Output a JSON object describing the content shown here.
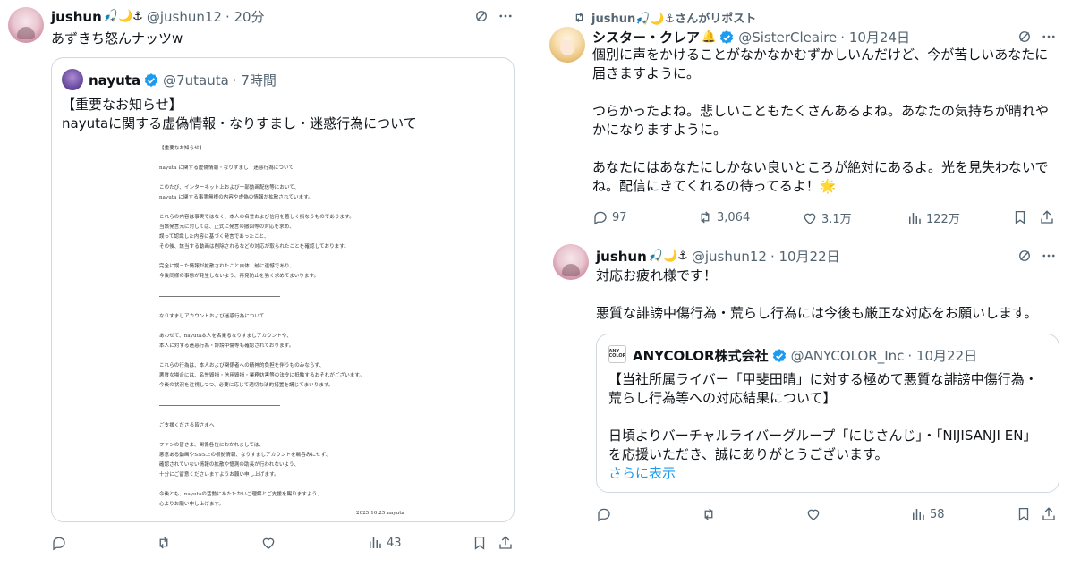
{
  "left_post": {
    "author_name": "jushun",
    "author_emoji": "🎣🌙⚓",
    "handle": "@jushun12",
    "time": "· 20分",
    "text": "あずきち怒んナッツw",
    "quote": {
      "author_name": "nayuta",
      "handle": "@7utauta",
      "time": "· 7時間",
      "text_line1": "【重要なお知らせ】",
      "text_line2": "nayutaに関する虚偽情報・なりすまし・迷惑行為について",
      "document": {
        "title": "【重要なお知らせ】",
        "subject": "nayuta に関する虚偽情報・なりすまし・迷惑行為について",
        "lines": [
          "このたび、インターネット上および一部動画配信等において、",
          "nayuta に関する事実無根の内容や虚偽の情報が拡散されています。",
          "これらの内容は事実ではなく、本人の名誉および信用を著しく損なうものであります。",
          "当該発言元に対しては、正式に発言の撤回等の対応を求め、",
          "誤って認識した内容に基づく発言であったこと、",
          "その後、該当する動画は削除されるなどの対応が取られたことを確認しております。",
          "完全に誤った情報が拡散されたこと自体、誠に遺憾であり、",
          "今後同様の事態が発生しないよう、再発防止を強く求めてまいります。",
          "なりすましアカウントおよび迷惑行為について",
          "あわせて、nayuta本人を名乗るなりすましアカウントや、",
          "本人に対する迷惑行為・誹謗中傷等も確認されております。",
          "これらの行為は、本人および関係者への精神的負担を伴うものみならず、",
          "悪質な場合には、名誉毀損・信用毀損・業務妨害等の法令に抵触するおそれがございます。",
          "今後の状況を注視しつつ、必要に応じて適切な法的措置を講じてまいります。",
          "ご支援くださる皆さまへ",
          "ファンの皆さま、関係各位におかれましては、",
          "悪意ある動画やSNS上の根拠情報、なりすましアカウントを鵜呑みにせず、",
          "確認されていない情報の拡散や憶測の助長が行われないよう、",
          "十分にご留意くださいますようお願い申し上げます。",
          "今後とも、nayutaの活動にあたたかいご理解とご支援を賜りますよう、",
          "心よりお願い申し上げます。"
        ],
        "date_sign": "2025.10.25 nayuta"
      }
    },
    "actions": {
      "views": "43"
    }
  },
  "right_repost_label": "jushun🎣🌙⚓さんがリポスト",
  "right_post1": {
    "author_name": "シスター・クレア",
    "author_emoji": "🔔",
    "handle": "@SisterCleaire",
    "time": "· 10月24日",
    "text": "個別に声をかけることがなかなかむずかしいんだけど、今が苦しいあなたに\n届きますように。\n\nつらかったよね。悲しいこともたくさんあるよね。あなたの気持ちが晴れや\nかになりますように。\n\nあなたにはあなたにしかない良いところが絶対にあるよ。光を見失わないで\nね。配信にきてくれるの待ってるよ！🌟",
    "actions": {
      "replies": "97",
      "reposts": "3,064",
      "likes": "3.1万",
      "views": "122万"
    }
  },
  "right_post2": {
    "author_name": "jushun",
    "author_emoji": "🎣🌙⚓",
    "handle": "@jushun12",
    "time": "· 10月22日",
    "text": "対応お疲れ様です！\n\n悪質な誹謗中傷行為・荒らし行為には今後も厳正な対応をお願いします。",
    "quote": {
      "author_name": "ANYCOLOR株式会社",
      "logo_text": "ANY COLOR",
      "handle": "@ANYCOLOR_Inc",
      "time": "· 10月22日",
      "text": "【当社所属ライバー「甲斐田晴」に対する極めて悪質な誹謗中傷行為・\n荒らし行為等への対応結果について】\n\n日頃よりバーチャルライバーグループ「にじさんじ」・「NIJISANJI EN」\nを応援いただき、誠にありがとうございます。",
      "show_more": "さらに表示"
    },
    "actions": {
      "views": "58"
    }
  },
  "colors": {
    "verified": "#1d9bf0",
    "verified_gold": "#e2b719",
    "muted": "#536471",
    "link": "#1d9bf0"
  }
}
